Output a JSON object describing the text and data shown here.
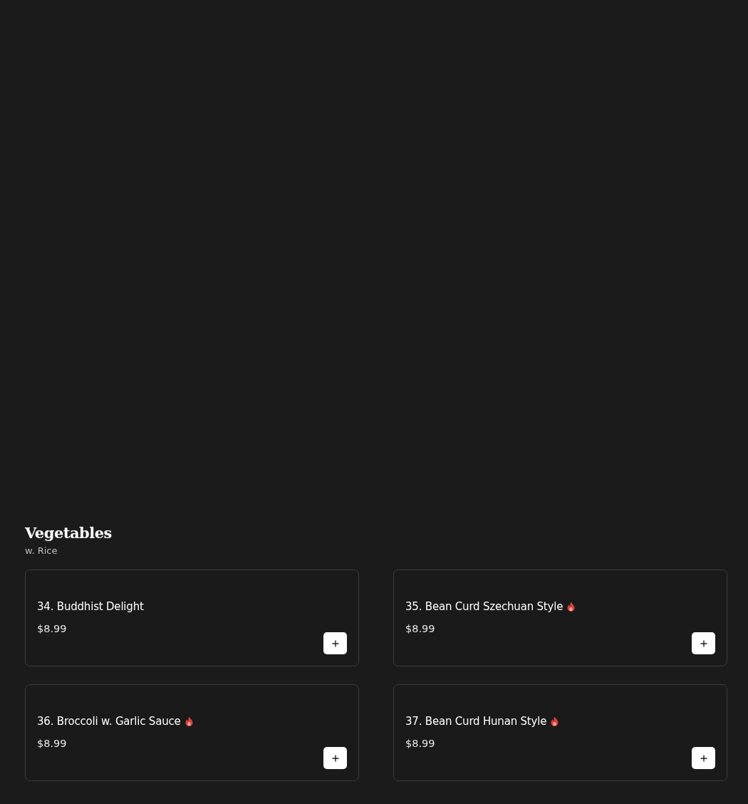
{
  "section": {
    "title": "Vegetables",
    "subtitle": "w. Rice"
  },
  "items": [
    {
      "name": "34. Buddhist Delight",
      "price": "$8.99",
      "spicy": false
    },
    {
      "name": "35. Bean Curd Szechuan Style",
      "price": "$8.99",
      "spicy": true
    },
    {
      "name": "36. Broccoli w. Garlic Sauce",
      "price": "$8.99",
      "spicy": true
    },
    {
      "name": "37. Bean Curd Hunan Style",
      "price": "$8.99",
      "spicy": true
    }
  ]
}
